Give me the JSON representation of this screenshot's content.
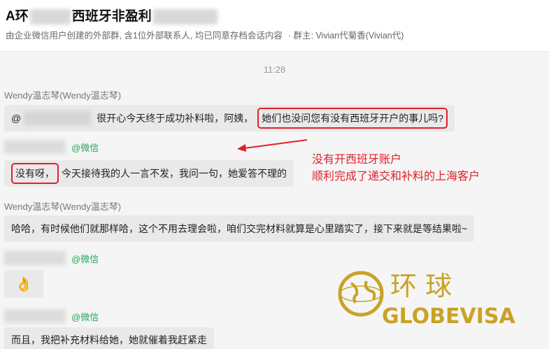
{
  "header": {
    "title_prefix": "A环",
    "title_suffix": "西班牙非盈利",
    "subtitle_main": "由企业微信用户创建的外部群, 含1位外部联系人, 均已同意存档会话内容",
    "subtitle_owner": "· 群主: Vivian代菊香(Vivian代)"
  },
  "chat": {
    "time": "11:28",
    "messages": [
      {
        "sender": "Wendy温志琴(Wendy温志琴)",
        "mention": "@",
        "text": "很开心今天终于成功补料啦，阿姨，",
        "highlight": "她们也没问您有没有西班牙开户的事儿吗?"
      },
      {
        "wx_tag": "@微信",
        "highlight": "没有呀，",
        "text": "今天接待我的人一言不发，我问一句，她爱答不理的"
      },
      {
        "sender": "Wendy温志琴(Wendy温志琴)",
        "text": "哈哈，有时候他们就那样哈，这个不用去理会啦，咱们交完材料就算是心里踏实了，接下来就是等结果啦~"
      },
      {
        "wx_tag": "@微信",
        "emoji": "👌"
      },
      {
        "wx_tag": "@微信",
        "text": "而且，我把补充材料给她，她就催着我赶紧走"
      }
    ]
  },
  "annotation": {
    "line1": "没有开西班牙账户",
    "line2": "顺利完成了递交和补料的上海客户",
    "color": "#e0202a"
  },
  "watermark": {
    "cn": "环  球",
    "en": "GLOBEVISA",
    "gold": "#c9a227"
  }
}
